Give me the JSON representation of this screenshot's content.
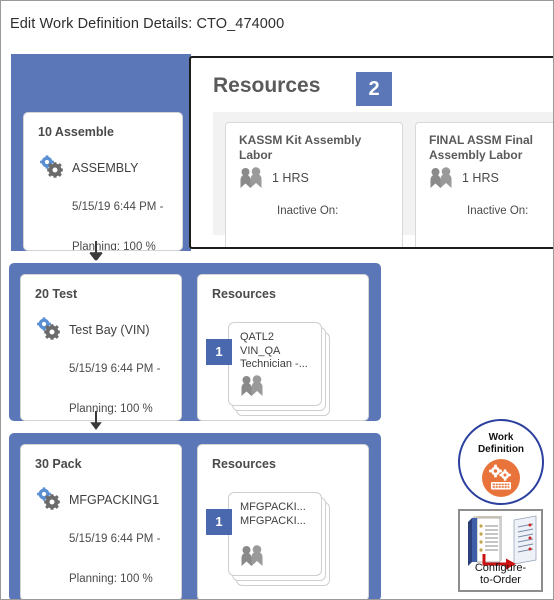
{
  "page": {
    "title": "Edit Work Definition Details: CTO_474000"
  },
  "colors": {
    "blue_block": "#5b77b8",
    "badge_blue": "#4a68ad",
    "orange": "#e8743b",
    "ring_blue": "#2b3f9e",
    "text_gray": "#4a4a4a"
  },
  "operations": [
    {
      "name": "10 Assemble",
      "work_center": "ASSEMBLY",
      "date": "5/15/19 6:44 PM -",
      "planning": "Planning: 100 %",
      "resources_title": "Resources",
      "resources_count": "2",
      "resource_cards": [
        {
          "name": "KASSM Kit Assembly Labor",
          "hours": "1 HRS",
          "inactive": "Inactive On:"
        },
        {
          "name": "FINAL ASSM Final Assembly Labor",
          "hours": "1 HRS",
          "inactive": "Inactive On:"
        }
      ]
    },
    {
      "name": "20 Test",
      "work_center": "Test Bay (VIN)",
      "date": "5/15/19 6:44 PM -",
      "planning": "Planning: 100 %",
      "resources_title": "Resources",
      "stack_badge": "1",
      "stack_text": "QATL2\nVIN_QA\nTechnician -..."
    },
    {
      "name": "30 Pack",
      "work_center": "MFGPACKING1",
      "date": "5/15/19 6:44 PM -",
      "planning": "Planning: 100 %",
      "resources_title": "Resources",
      "stack_badge": "1",
      "stack_text": "MFGPACKI...\nMFGPACKI..."
    }
  ],
  "work_definition_badge": {
    "line1": "Work",
    "line2": "Definition"
  },
  "configure_to_order": {
    "line1": "Configure-",
    "line2": "to-Order"
  }
}
